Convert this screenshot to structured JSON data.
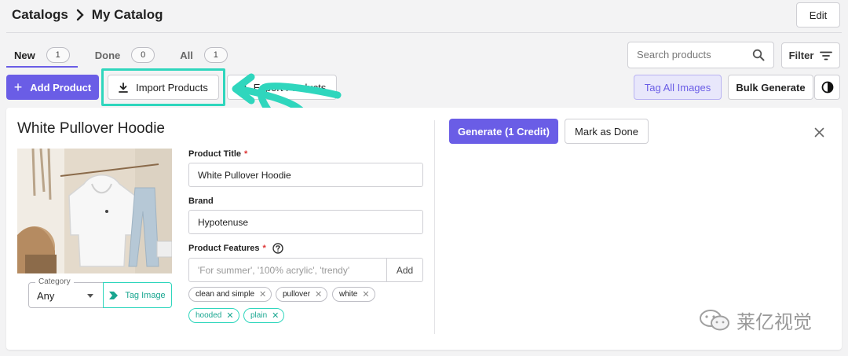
{
  "breadcrumb": {
    "root": "Catalogs",
    "current": "My Catalog"
  },
  "header": {
    "edit_label": "Edit"
  },
  "tabs": [
    {
      "label": "New",
      "count": "1",
      "active": true
    },
    {
      "label": "Done",
      "count": "0",
      "active": false
    },
    {
      "label": "All",
      "count": "1",
      "active": false
    }
  ],
  "search": {
    "placeholder": "Search products"
  },
  "filter": {
    "label": "Filter"
  },
  "toolbar": {
    "add_product": "Add Product",
    "import_products": "Import Products",
    "export_products": "Export Products",
    "tag_all_images": "Tag All Images",
    "bulk_generate": "Bulk Generate"
  },
  "product": {
    "title": "White Pullover Hoodie",
    "category_label": "Category",
    "category_value": "Any",
    "tag_image": "Tag Image",
    "fields": {
      "title_label": "Product Title",
      "title_value": "White Pullover Hoodie",
      "brand_label": "Brand",
      "brand_value": "Hypotenuse",
      "features_label": "Product Features",
      "features_placeholder": "'For summer', '100% acrylic', 'trendy'",
      "features_add": "Add",
      "required_mark": "*"
    },
    "features": [
      {
        "label": "clean and simple",
        "style": "grey"
      },
      {
        "label": "pullover",
        "style": "grey"
      },
      {
        "label": "white",
        "style": "grey"
      },
      {
        "label": "hooded",
        "style": "teal"
      },
      {
        "label": "plain",
        "style": "teal"
      }
    ],
    "actions": {
      "generate": "Generate (1 Credit)",
      "mark_done": "Mark as Done"
    }
  },
  "watermark": {
    "text": "莱亿视觉"
  },
  "colors": {
    "accent": "#6a5de6",
    "highlight": "#2fd6bd",
    "required": "#dd3333"
  },
  "icons": [
    "chevron-right-icon",
    "search-icon",
    "filter-icon",
    "plus-icon",
    "download-icon",
    "upload-icon",
    "contrast-icon",
    "help-icon",
    "close-icon",
    "tag-icon",
    "chip-remove-icon",
    "wechat-icon"
  ]
}
